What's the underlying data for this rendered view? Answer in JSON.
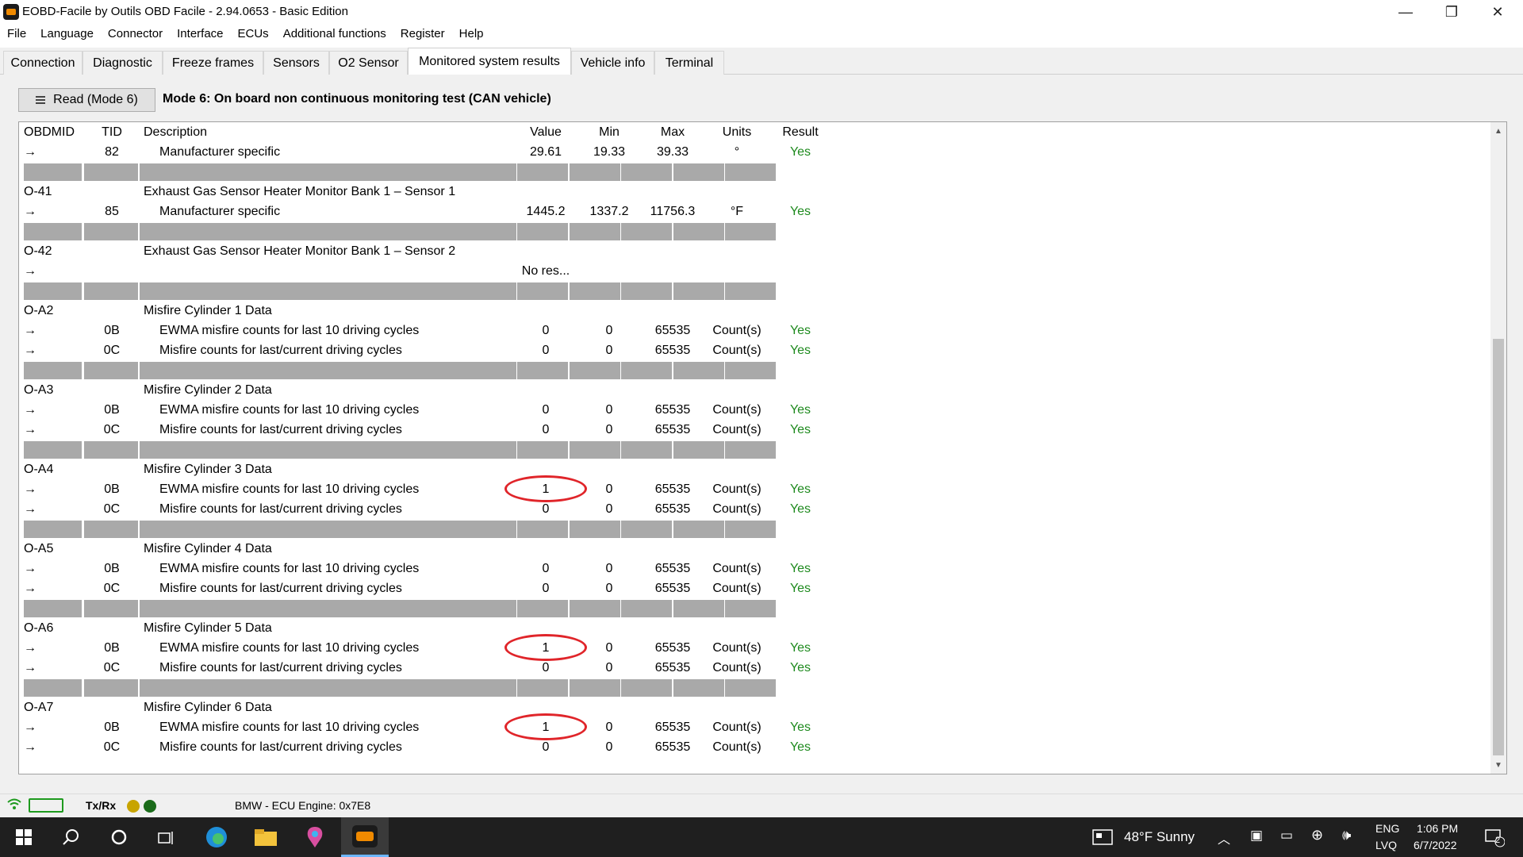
{
  "window": {
    "title": "EOBD-Facile by Outils OBD Facile - 2.94.0653 - Basic Edition",
    "min_glyph": "—",
    "max_glyph": "❐",
    "close_glyph": "✕"
  },
  "menu": [
    "File",
    "Language",
    "Connector",
    "Interface",
    "ECUs",
    "Additional functions",
    "Register",
    "Help"
  ],
  "tabs": [
    "Connection",
    "Diagnostic",
    "Freeze frames",
    "Sensors",
    "O2 Sensor",
    "Monitored system results",
    "Vehicle info",
    "Terminal"
  ],
  "toolbar": {
    "read_label": "Read (Mode 6)",
    "mode_title": "Mode 6: On board non continuous monitoring test (CAN vehicle)"
  },
  "columns": {
    "obdmid": "OBDMID",
    "tid": "TID",
    "desc": "Description",
    "value": "Value",
    "min": "Min",
    "max": "Max",
    "units": "Units",
    "result": "Result"
  },
  "arrow": "→",
  "rows": [
    {
      "obd": "→",
      "tid": "82",
      "desc": "Manufacturer specific",
      "val": "29.61",
      "min": "19.33",
      "max": "39.33",
      "unit": "°",
      "res": "Yes",
      "indent": true
    },
    {
      "sep": true
    },
    {
      "obd": "O-41",
      "tid": "",
      "desc": "Exhaust Gas Sensor Heater Monitor Bank 1 – Sensor 1"
    },
    {
      "obd": "→",
      "tid": "85",
      "desc": "Manufacturer specific",
      "val": "1445.2",
      "min": "1337.2",
      "max": "11756.3",
      "unit": "°F",
      "res": "Yes",
      "indent": true
    },
    {
      "sep": true
    },
    {
      "obd": "O-42",
      "tid": "",
      "desc": "Exhaust Gas Sensor Heater Monitor Bank 1 – Sensor 2"
    },
    {
      "obd": "→",
      "tid": "",
      "desc": "",
      "val": "No res..."
    },
    {
      "sep": true
    },
    {
      "obd": "O-A2",
      "tid": "",
      "desc": "Misfire Cylinder 1 Data"
    },
    {
      "obd": "→",
      "tid": "0B",
      "desc": "EWMA misfire counts for last 10 driving cycles",
      "val": "0",
      "min": "0",
      "max": "65535",
      "unit": "Count(s)",
      "res": "Yes",
      "indent": true
    },
    {
      "obd": "→",
      "tid": "0C",
      "desc": "Misfire counts for last/current driving cycles",
      "val": "0",
      "min": "0",
      "max": "65535",
      "unit": "Count(s)",
      "res": "Yes",
      "indent": true
    },
    {
      "sep": true
    },
    {
      "obd": "O-A3",
      "tid": "",
      "desc": "Misfire Cylinder 2 Data"
    },
    {
      "obd": "→",
      "tid": "0B",
      "desc": "EWMA misfire counts for last 10 driving cycles",
      "val": "0",
      "min": "0",
      "max": "65535",
      "unit": "Count(s)",
      "res": "Yes",
      "indent": true
    },
    {
      "obd": "→",
      "tid": "0C",
      "desc": "Misfire counts for last/current driving cycles",
      "val": "0",
      "min": "0",
      "max": "65535",
      "unit": "Count(s)",
      "res": "Yes",
      "indent": true
    },
    {
      "sep": true
    },
    {
      "obd": "O-A4",
      "tid": "",
      "desc": "Misfire Cylinder 3 Data"
    },
    {
      "obd": "→",
      "tid": "0B",
      "desc": "EWMA misfire counts for last 10 driving cycles",
      "val": "1",
      "min": "0",
      "max": "65535",
      "unit": "Count(s)",
      "res": "Yes",
      "indent": true,
      "circled": true
    },
    {
      "obd": "→",
      "tid": "0C",
      "desc": "Misfire counts for last/current driving cycles",
      "val": "0",
      "min": "0",
      "max": "65535",
      "unit": "Count(s)",
      "res": "Yes",
      "indent": true
    },
    {
      "sep": true
    },
    {
      "obd": "O-A5",
      "tid": "",
      "desc": "Misfire Cylinder 4 Data"
    },
    {
      "obd": "→",
      "tid": "0B",
      "desc": "EWMA misfire counts for last 10 driving cycles",
      "val": "0",
      "min": "0",
      "max": "65535",
      "unit": "Count(s)",
      "res": "Yes",
      "indent": true
    },
    {
      "obd": "→",
      "tid": "0C",
      "desc": "Misfire counts for last/current driving cycles",
      "val": "0",
      "min": "0",
      "max": "65535",
      "unit": "Count(s)",
      "res": "Yes",
      "indent": true
    },
    {
      "sep": true
    },
    {
      "obd": "O-A6",
      "tid": "",
      "desc": "Misfire Cylinder 5 Data"
    },
    {
      "obd": "→",
      "tid": "0B",
      "desc": "EWMA misfire counts for last 10 driving cycles",
      "val": "1",
      "min": "0",
      "max": "65535",
      "unit": "Count(s)",
      "res": "Yes",
      "indent": true,
      "circled": true
    },
    {
      "obd": "→",
      "tid": "0C",
      "desc": "Misfire counts for last/current driving cycles",
      "val": "0",
      "min": "0",
      "max": "65535",
      "unit": "Count(s)",
      "res": "Yes",
      "indent": true
    },
    {
      "sep": true
    },
    {
      "obd": "O-A7",
      "tid": "",
      "desc": "Misfire Cylinder 6 Data"
    },
    {
      "obd": "→",
      "tid": "0B",
      "desc": "EWMA misfire counts for last 10 driving cycles",
      "val": "1",
      "min": "0",
      "max": "65535",
      "unit": "Count(s)",
      "res": "Yes",
      "indent": true,
      "circled": true
    },
    {
      "obd": "→",
      "tid": "0C",
      "desc": "Misfire counts for last/current driving cycles",
      "val": "0",
      "min": "0",
      "max": "65535",
      "unit": "Count(s)",
      "res": "Yes",
      "indent": true
    }
  ],
  "status": {
    "txrx": "Tx/Rx",
    "ecu": "BMW - ECU Engine: 0x7E8",
    "led_yellow": "#c8a400",
    "led_green": "#1a6b1a"
  },
  "colors": {
    "result_yes": "#1e8a1e",
    "annotation": "#e0252a",
    "separator": "#a9a9a9"
  },
  "taskbar": {
    "weather": "48°F  Sunny",
    "lang_top": "ENG",
    "lang_bottom": "LVQ",
    "time": "1:06 PM",
    "date": "6/7/2022",
    "notif_count": "2"
  }
}
